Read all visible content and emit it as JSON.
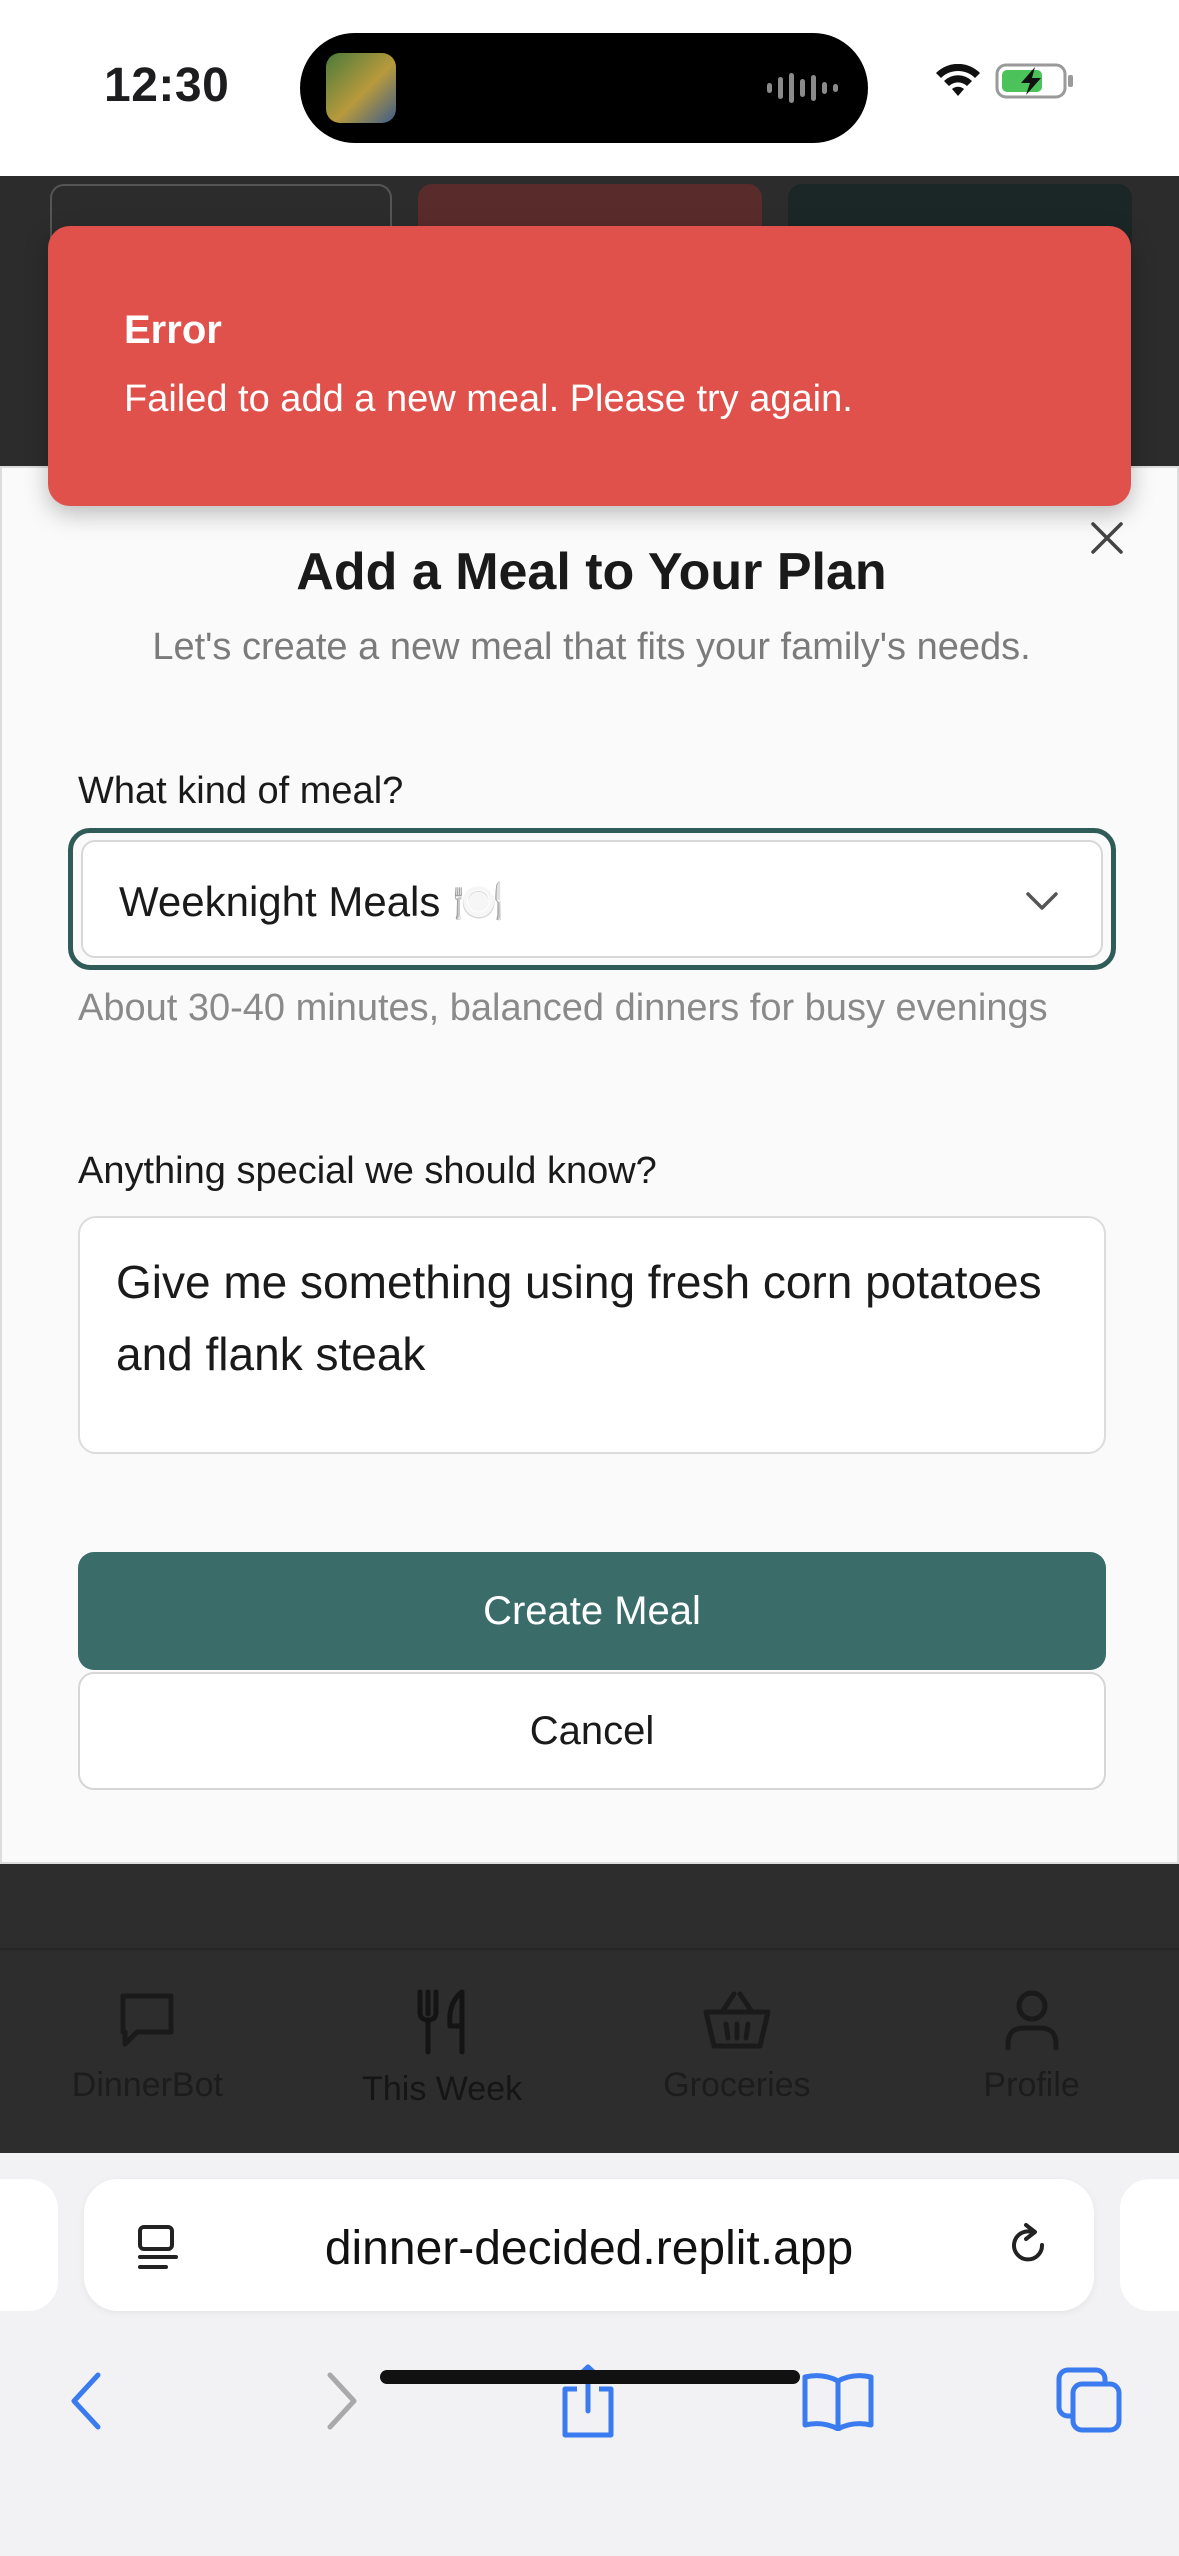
{
  "status_bar": {
    "time": "12:30"
  },
  "toast": {
    "title": "Error",
    "message": "Failed to add a new meal. Please try again.",
    "color": "#df514a"
  },
  "modal": {
    "title": "Add a Meal to Your Plan",
    "subtitle": "Let's create a new meal that fits your family's needs.",
    "meal_type_label": "What kind of meal?",
    "meal_type_value": "Weeknight Meals 🍽️",
    "meal_type_helper": "About 30-40 minutes, balanced dinners for busy evenings",
    "notes_label": "Anything special we should know?",
    "notes_value": "Give me something using fresh corn potatoes and flank steak",
    "create_label": "Create Meal",
    "cancel_label": "Cancel",
    "accent_color": "#3a6d69"
  },
  "tab_bar": {
    "items": [
      {
        "label": "DinnerBot",
        "icon": "chat-bubble-icon"
      },
      {
        "label": "This Week",
        "icon": "fork-knife-icon",
        "active": true
      },
      {
        "label": "Groceries",
        "icon": "basket-icon"
      },
      {
        "label": "Profile",
        "icon": "person-icon"
      }
    ]
  },
  "browser": {
    "url": "dinner-decided.replit.app"
  }
}
